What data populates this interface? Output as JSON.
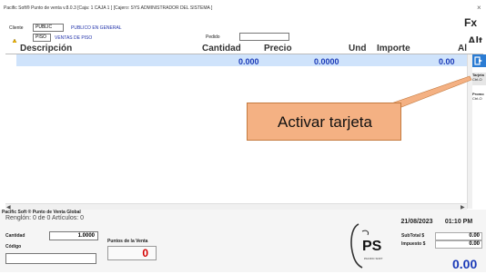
{
  "window": {
    "title": "Pacific Soft® Punto de venta v.8.0.3   [Caja: 1 CAJA 1 ]   [Cajero: SYS ADMINISTRADOR DEL SISTEMA ]",
    "close_symbol": "×"
  },
  "right_actions": {
    "f_label": "Fx",
    "alt_label": "Alt"
  },
  "customer": {
    "label": "Cliente",
    "code": "PUBLIC",
    "name": "PUBLICO EN GENERAL",
    "type_code": "PISO",
    "type_name": "VENTAS DE PISO",
    "pedido_label": "Pedido",
    "pedido_value": ""
  },
  "grid": {
    "columns": [
      "Descripción",
      "Cantidad",
      "Precio",
      "Und",
      "Importe",
      "Al"
    ],
    "row": {
      "description": "",
      "cantidad": "0.000",
      "precio": "0.0000",
      "und": "",
      "importe": "0.00"
    }
  },
  "side_buttons": {
    "tarjeta_label": "Tarjeta",
    "tarjeta_sub": "Ctrl-O",
    "promo_label": "Promo",
    "promo_sub": "Ctrl-O"
  },
  "callout": {
    "text": "Activar tarjeta"
  },
  "footer": {
    "app_name": "Pacific Soft ® Punto de Venta Global",
    "status": "Renglón: 0 de 0   Artículos: 0",
    "cantidad_label": "Cantidad",
    "cantidad_value": "1.0000",
    "codigo_label": "Código",
    "codigo_value": "",
    "puntos_label": "Puntos de la Venta",
    "puntos_value": "0",
    "logo_text": "PS",
    "logo_sub": "PACIFIC SOFT",
    "date": "21/08/2023",
    "time": "01:10 PM",
    "subtotal_label": "SubTotal $",
    "subtotal_value": "0.00",
    "impuesto_label": "Impuesto $",
    "impuesto_value": "0.00",
    "total": "0.00"
  }
}
